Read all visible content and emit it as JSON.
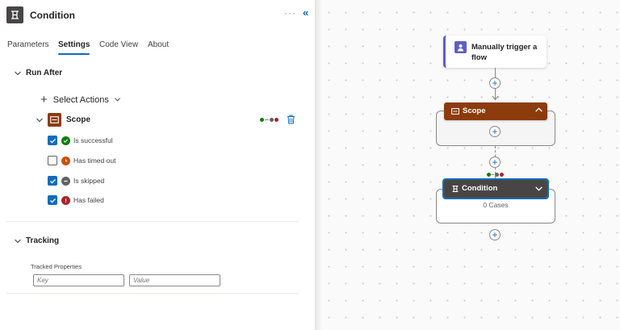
{
  "panel": {
    "title": "Condition",
    "more_label": "···",
    "collapse_label": "«",
    "tabs": [
      {
        "label": "Parameters"
      },
      {
        "label": "Settings"
      },
      {
        "label": "Code View"
      },
      {
        "label": "About"
      }
    ],
    "active_tab": "Settings",
    "run_after": {
      "heading": "Run After",
      "select_actions_label": "Select Actions",
      "action_name": "Scope",
      "statuses": [
        {
          "label": "Is successful",
          "checked": true,
          "color": "#107c10"
        },
        {
          "label": "Has timed out",
          "checked": false,
          "color": "#ca5010"
        },
        {
          "label": "Is skipped",
          "checked": true,
          "color": "#616161"
        },
        {
          "label": "Has failed",
          "checked": true,
          "color": "#a4262c"
        }
      ]
    },
    "tracking": {
      "heading": "Tracking",
      "tracked_properties_label": "Tracked Properties",
      "key_placeholder": "Key",
      "value_placeholder": "Value"
    }
  },
  "canvas": {
    "trigger_label": "Manually trigger a flow",
    "scope_label": "Scope",
    "condition_label": "Condition",
    "cases_label": "0 Cases"
  },
  "colors": {
    "accent": "#0f6cbd",
    "trigger": "#5b5fc7",
    "scope": "#8c3b0c",
    "condition": "#484644"
  }
}
